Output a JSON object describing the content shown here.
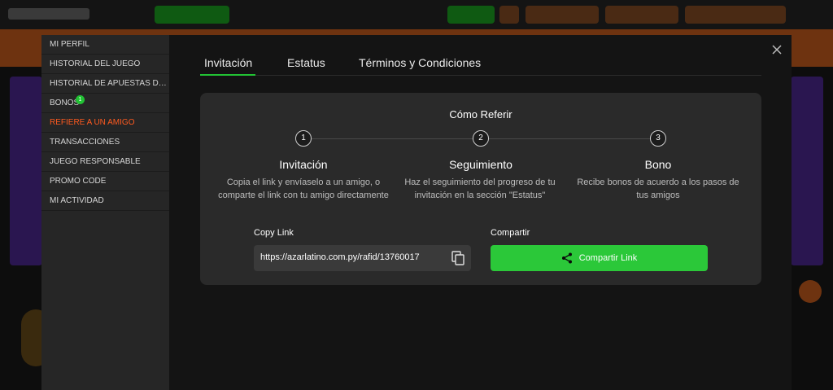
{
  "sidebar": {
    "items": [
      {
        "label": "MI PERFIL"
      },
      {
        "label": "HISTORIAL DEL JUEGO"
      },
      {
        "label": "HISTORIAL DE APUESTAS DEPORTIVAS"
      },
      {
        "label": "BONOS",
        "badge": "1"
      },
      {
        "label": "REFIERE A UN AMIGO"
      },
      {
        "label": "TRANSACCIONES"
      },
      {
        "label": "JUEGO RESPONSABLE"
      },
      {
        "label": "PROMO CODE"
      },
      {
        "label": "MI ACTIVIDAD"
      }
    ],
    "active_index": 4
  },
  "tabs": [
    {
      "label": "Invitación"
    },
    {
      "label": "Estatus"
    },
    {
      "label": "Términos y Condiciones"
    }
  ],
  "card": {
    "title": "Cómo Referir",
    "steps": [
      {
        "number": "1",
        "title": "Invitación",
        "description": "Copia el link y envíaselo a un amigo, o comparte el link con tu amigo directamente"
      },
      {
        "number": "2",
        "title": "Seguimiento",
        "description": "Haz el seguimiento del progreso de tu invitación en la sección \"Estatus\""
      },
      {
        "number": "3",
        "title": "Bono",
        "description": "Recibe bonos de acuerdo a los pasos de tus amigos"
      }
    ],
    "copy_label": "Copy Link",
    "link_value": "https://azarlatino.com.py/rafid/13760017",
    "share_label": "Compartir",
    "share_button": "Compartir Link"
  },
  "icons": {
    "close": "close-icon",
    "copy": "copy-icon",
    "share": "share-icon"
  },
  "colors": {
    "accent_green": "#2bc839",
    "active_orange": "#ff5a1f",
    "badge_green": "#22c234"
  }
}
